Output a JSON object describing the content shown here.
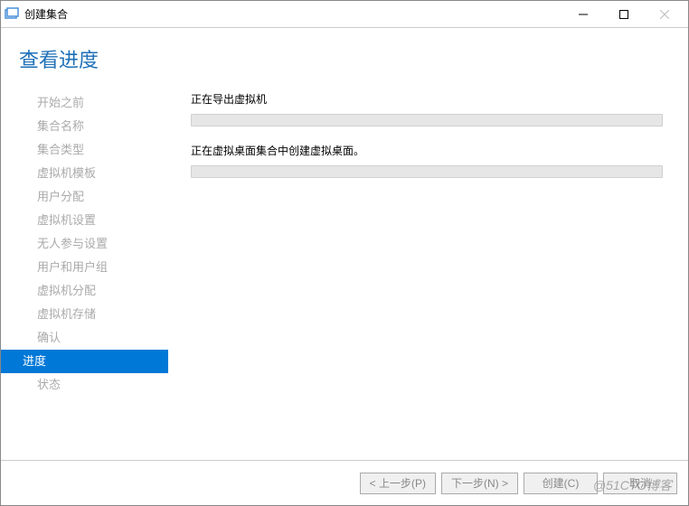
{
  "titlebar": {
    "title": "创建集合"
  },
  "header": {
    "title": "查看进度"
  },
  "sidebar": {
    "items": [
      {
        "label": "开始之前"
      },
      {
        "label": "集合名称"
      },
      {
        "label": "集合类型"
      },
      {
        "label": "虚拟机模板"
      },
      {
        "label": "用户分配"
      },
      {
        "label": "虚拟机设置"
      },
      {
        "label": "无人参与设置"
      },
      {
        "label": "用户和用户组"
      },
      {
        "label": "虚拟机分配"
      },
      {
        "label": "虚拟机存储"
      },
      {
        "label": "确认"
      },
      {
        "label": "进度"
      },
      {
        "label": "状态"
      }
    ]
  },
  "main": {
    "progress1_label": "正在导出虚拟机",
    "progress2_label": "正在虚拟桌面集合中创建虚拟桌面。"
  },
  "footer": {
    "prev": "< 上一步(P)",
    "next": "下一步(N) >",
    "create": "创建(C)",
    "cancel": "取消"
  },
  "watermark": "@51CTO博客"
}
